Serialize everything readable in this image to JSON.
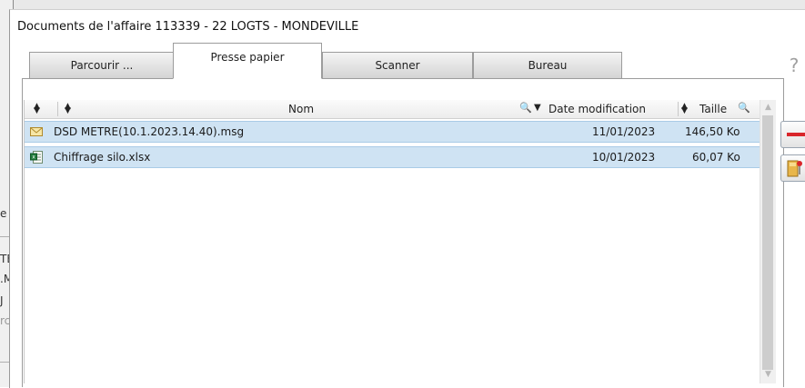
{
  "window": {
    "title": "Documents de l'affaire 113339 - 22 LOGTS - MONDEVILLE"
  },
  "background_fragments": [
    "e",
    "TE",
    ".M",
    "J",
    "rc"
  ],
  "tabs": [
    {
      "label": "Parcourir ...",
      "active": false
    },
    {
      "label": "Presse papier",
      "active": true
    },
    {
      "label": "Scanner",
      "active": false
    },
    {
      "label": "Bureau",
      "active": false
    }
  ],
  "table": {
    "columns": {
      "name": "Nom",
      "date": "Date modification",
      "size": "Taille"
    },
    "rows": [
      {
        "icon": "email-icon",
        "name": "DSD METRE(10.1.2023.14.40).msg",
        "date": "11/01/2023",
        "size": "146,50 Ko"
      },
      {
        "icon": "excel-file-icon",
        "name": "Chiffrage silo.xlsx",
        "date": "10/01/2023",
        "size": "60,07 Ko"
      }
    ]
  },
  "colors": {
    "row_selected": "#cfe3f3",
    "remove_button": "#d9262b"
  }
}
